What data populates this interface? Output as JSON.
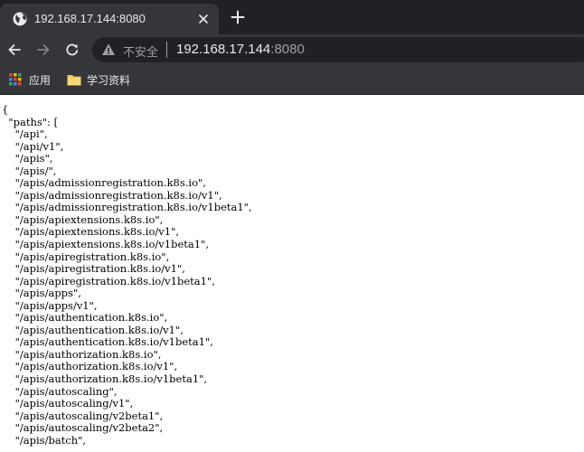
{
  "tab": {
    "title": "192.168.17.144:8080",
    "favicon": "globe-icon"
  },
  "toolbar": {
    "security_label": "不安全",
    "url_host": "192.168.17.144",
    "url_port": ":8080"
  },
  "bookmarks": [
    {
      "label": "应用",
      "icon": "apps-grid-icon"
    },
    {
      "label": "学习资料",
      "icon": "folder-icon"
    }
  ],
  "content": {
    "lines": [
      "{",
      "  \"paths\": [",
      "    \"/api\",",
      "    \"/api/v1\",",
      "    \"/apis\",",
      "    \"/apis/\",",
      "    \"/apis/admissionregistration.k8s.io\",",
      "    \"/apis/admissionregistration.k8s.io/v1\",",
      "    \"/apis/admissionregistration.k8s.io/v1beta1\",",
      "    \"/apis/apiextensions.k8s.io\",",
      "    \"/apis/apiextensions.k8s.io/v1\",",
      "    \"/apis/apiextensions.k8s.io/v1beta1\",",
      "    \"/apis/apiregistration.k8s.io\",",
      "    \"/apis/apiregistration.k8s.io/v1\",",
      "    \"/apis/apiregistration.k8s.io/v1beta1\",",
      "    \"/apis/apps\",",
      "    \"/apis/apps/v1\",",
      "    \"/apis/authentication.k8s.io\",",
      "    \"/apis/authentication.k8s.io/v1\",",
      "    \"/apis/authentication.k8s.io/v1beta1\",",
      "    \"/apis/authorization.k8s.io\",",
      "    \"/apis/authorization.k8s.io/v1\",",
      "    \"/apis/authorization.k8s.io/v1beta1\",",
      "    \"/apis/autoscaling\",",
      "    \"/apis/autoscaling/v1\",",
      "    \"/apis/autoscaling/v2beta1\",",
      "    \"/apis/autoscaling/v2beta2\",",
      "    \"/apis/batch\","
    ]
  }
}
